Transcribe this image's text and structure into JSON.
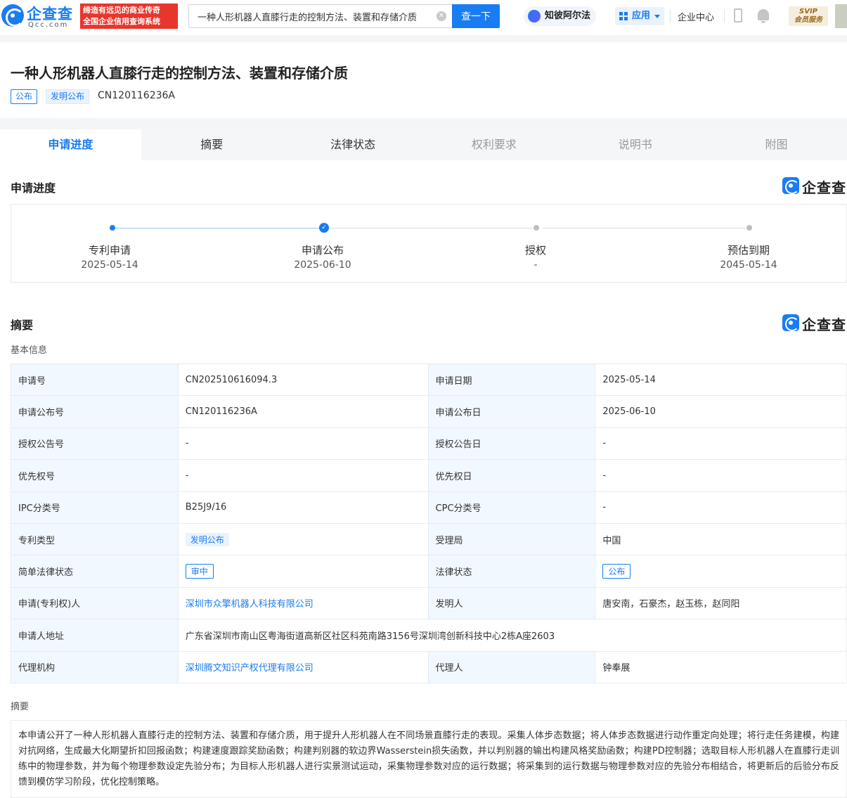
{
  "topbar": {
    "logo_text": "企查查",
    "logo_sub": "Qcc.com",
    "slogan_line1": "缔造有远见的商业传奇",
    "slogan_line2": "全国企业信用查询系统",
    "search_value": "一种人形机器人直膝行走的控制方法、装置和存储介质",
    "search_button": "查一下",
    "zhibi": "知彼阿尔法",
    "app_button": "应用",
    "enterprise_center": "企业中心",
    "svip_top": "SVIP",
    "svip_bottom": "会员服务"
  },
  "header": {
    "title": "一种人形机器人直膝行走的控制方法、装置和存储介质",
    "tag_status": "公布",
    "tag_type": "发明公布",
    "publication_no": "CN120116236A"
  },
  "tabs": [
    {
      "label": "申请进度",
      "state": "active"
    },
    {
      "label": "摘要",
      "state": "normal"
    },
    {
      "label": "法律状态",
      "state": "normal"
    },
    {
      "label": "权利要求",
      "state": "disabled"
    },
    {
      "label": "说明书",
      "state": "disabled"
    },
    {
      "label": "附图",
      "state": "disabled"
    }
  ],
  "progress": {
    "title": "申请进度",
    "brand": "企查查",
    "steps": [
      {
        "label": "专利申请",
        "date": "2025-05-14",
        "state": "done"
      },
      {
        "label": "申请公布",
        "date": "2025-06-10",
        "state": "current"
      },
      {
        "label": "授权",
        "date": "-",
        "state": "pending"
      },
      {
        "label": "预估到期",
        "date": "2045-05-14",
        "state": "pending"
      }
    ]
  },
  "summary": {
    "title": "摘要",
    "brand": "企查查",
    "basic_info_label": "基本信息",
    "rows": [
      {
        "l1": "申请号",
        "v1": "CN202510616094.3",
        "l2": "申请日期",
        "v2": "2025-05-14"
      },
      {
        "l1": "申请公布号",
        "v1": "CN120116236A",
        "l2": "申请公布日",
        "v2": "2025-06-10"
      },
      {
        "l1": "授权公告号",
        "v1": "-",
        "l2": "授权公告日",
        "v2": "-"
      },
      {
        "l1": "优先权号",
        "v1": "-",
        "l2": "优先权日",
        "v2": "-"
      },
      {
        "l1": "IPC分类号",
        "v1": "B25J9/16",
        "l2": "CPC分类号",
        "v2": "-"
      },
      {
        "l1": "专利类型",
        "v1": "发明公布",
        "l2": "受理局",
        "v2": "中国"
      },
      {
        "l1": "简单法律状态",
        "v1": "审中",
        "l2": "法律状态",
        "v2": "公布"
      },
      {
        "l1": "申请(专利权)人",
        "v1": "深圳市众擎机器人科技有限公司",
        "l2": "发明人",
        "v2": "唐安南，石豪杰，赵玉栋，赵同阳"
      },
      {
        "l1": "申请人地址",
        "v1": "广东省深圳市南山区粤海街道高新区社区科苑南路3156号深圳湾创新科技中心2栋A座2603"
      },
      {
        "l1": "代理机构",
        "v1": "深圳腾文知识产权代理有限公司",
        "l2": "代理人",
        "v2": "钟奉展"
      }
    ],
    "abstract_label": "摘要",
    "abstract_text": "本申请公开了一种人形机器人直膝行走的控制方法、装置和存储介质，用于提升人形机器人在不同场景直膝行走的表现。采集人体步态数据；将人体步态数据进行动作重定向处理；将行走任务建模，构建对抗网络，生成最大化期望折扣回报函数；构建速度跟踪奖励函数；构建判别器的软边界Wasserstein损失函数，并以判别器的输出构建风格奖励函数；构建PD控制器；选取目标人形机器人在直膝行走训练中的物理参数，并为每个物理参数设定先验分布；为目标人形机器人进行实景测试运动，采集物理参数对应的运行数据；将采集到的运行数据与物理参数对应的先验分布相结合，将更新后的后验分布反馈到模仿学习阶段，优化控制策略。"
  },
  "colors": {
    "accent": "#1a7cf2",
    "slogan_bg": "#e8362c",
    "label_bg": "#f2f8ff"
  }
}
